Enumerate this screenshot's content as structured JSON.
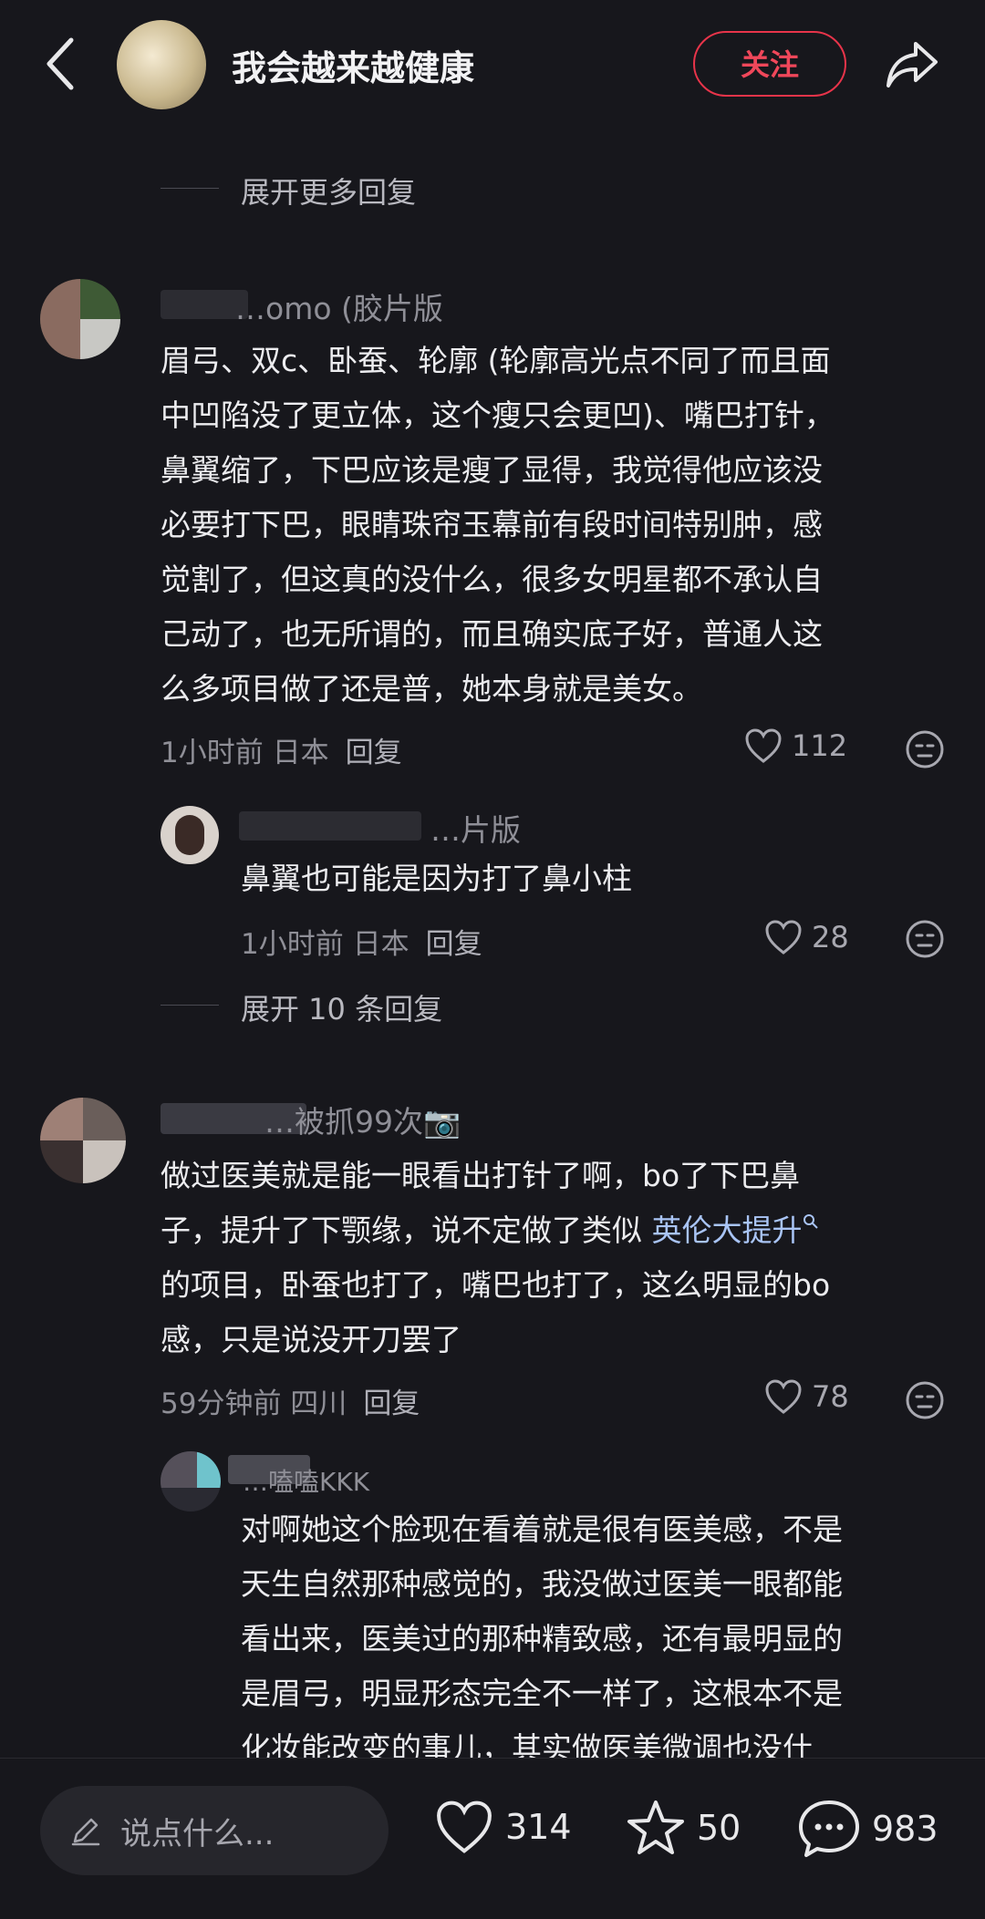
{
  "header": {
    "title": "我会越来越健康",
    "follow_label": "关注"
  },
  "thread_top": {
    "expand_more": "展开更多回复"
  },
  "comments": [
    {
      "username": "…omo (胶片版",
      "text_lines": [
        "眉弓、双c、卧蚕、轮廓 (轮廓高光点不同了而且面",
        "中凹陷没了更立体，这个瘦只会更凹)、嘴巴打针，",
        "鼻翼缩了，下巴应该是瘦了显得，我觉得他应该没",
        "必要打下巴，眼睛珠帘玉幕前有段时间特别肿，感",
        "觉割了，但这真的没什么，很多女明星都不承认自",
        "己动了，也无所谓的，而且确实底子好，普通人这",
        "么多项目做了还是普，她本身就是美女。"
      ],
      "time_location": "1小时前 日本",
      "reply_label": "回复",
      "likes": "112"
    },
    {
      "username": "…片版",
      "text": "鼻翼也可能是因为打了鼻小柱",
      "time_location": "1小时前 日本",
      "reply_label": "回复",
      "likes": "28",
      "expand": "展开 10 条回复"
    },
    {
      "username": "…被抓99次📷",
      "line1": "做过医美就是能一眼看出打针了啊，bo了下巴鼻",
      "line2_prefix": "子，提升了下颚缘，说不定做了类似 ",
      "line2_link": "英伦大提升",
      "line3": "的项目，卧蚕也打了，嘴巴也打了，这么明显的bo",
      "line4": "感，只是说没开刀罢了",
      "time_location": "59分钟前 四川",
      "reply_label": "回复",
      "likes": "78"
    },
    {
      "username": "…嗑嗑KKK",
      "text_lines": [
        "对啊她这个脸现在看着就是很有医美感，不是",
        "天生自然那种感觉的，我没做过医美一眼都能",
        "看出来，医美过的那种精致感，还有最明显的",
        "是眉弓，明显形态完全不一样了，这根本不是",
        "化妆能改变的事儿，其实做医美微调也没什"
      ]
    }
  ],
  "bottom_bar": {
    "input_placeholder": "说点什么...",
    "likes": "314",
    "favorites": "50",
    "comments": "983"
  },
  "colors": {
    "background": "#17171c",
    "accent": "#e8344a",
    "link": "#a9c4f5"
  }
}
